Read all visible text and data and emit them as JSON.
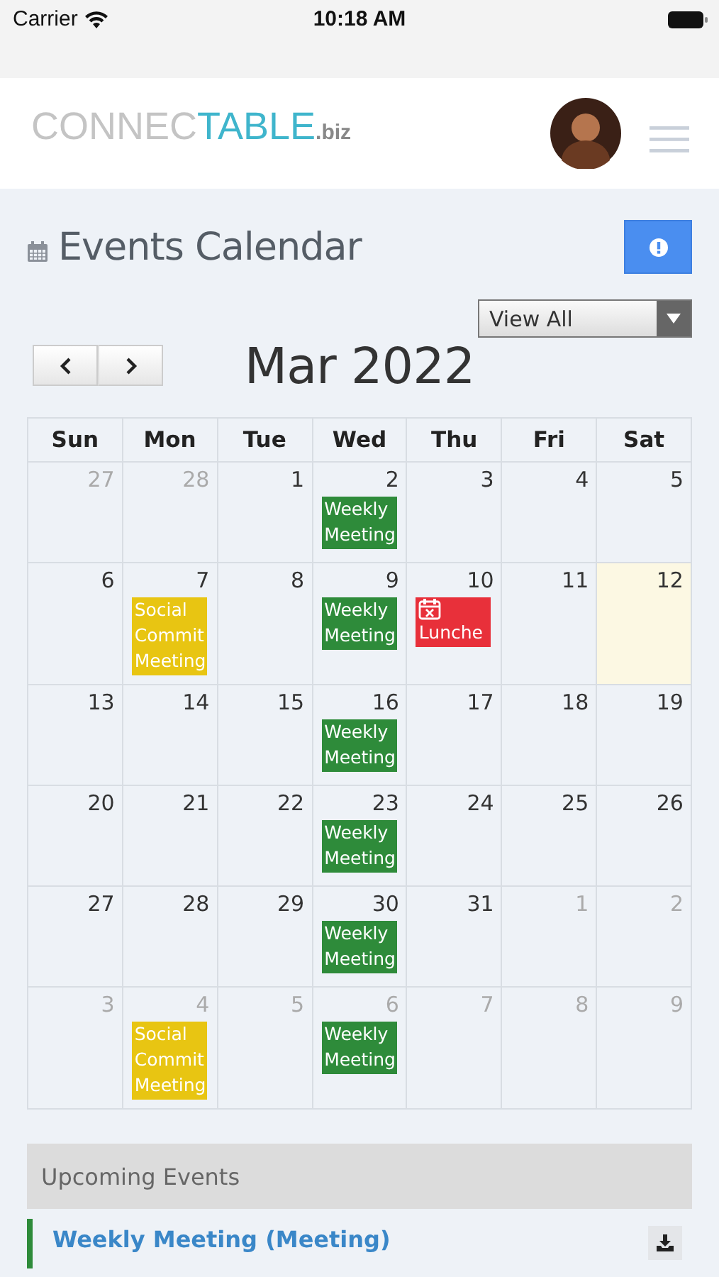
{
  "status_bar": {
    "carrier": "Carrier",
    "time": "10:18 AM"
  },
  "header": {
    "logo": {
      "part_1": "CONNEC",
      "part_2": "TABLE",
      "suffix": ".biz"
    }
  },
  "page": {
    "title": "Events Calendar"
  },
  "filter": {
    "value": "View All"
  },
  "calendar": {
    "month": "Mar 2022",
    "weekdays": [
      "Sun",
      "Mon",
      "Tue",
      "Wed",
      "Thu",
      "Fri",
      "Sat"
    ],
    "weeks": [
      [
        {
          "day": "27",
          "other_month": true,
          "today": false
        },
        {
          "day": "28",
          "other_month": true,
          "today": false
        },
        {
          "day": "1",
          "other_month": false,
          "today": false
        },
        {
          "day": "2",
          "other_month": false,
          "today": false,
          "events": [
            {
              "title": "Weekly Meeting",
              "kind": "meeting",
              "color": "#2e8b3a"
            }
          ]
        },
        {
          "day": "3",
          "other_month": false,
          "today": false
        },
        {
          "day": "4",
          "other_month": false,
          "today": false
        },
        {
          "day": "5",
          "other_month": false,
          "today": false
        }
      ],
      [
        {
          "day": "6",
          "other_month": false,
          "today": false
        },
        {
          "day": "7",
          "other_month": false,
          "today": false,
          "events": [
            {
              "title": "Social Commit Meeting",
              "kind": "meeting",
              "color": "#e8c512"
            }
          ]
        },
        {
          "day": "8",
          "other_month": false,
          "today": false
        },
        {
          "day": "9",
          "other_month": false,
          "today": false,
          "events": [
            {
              "title": "Weekly Meeting",
              "kind": "meeting",
              "color": "#2e8b3a"
            }
          ]
        },
        {
          "day": "10",
          "other_month": false,
          "today": false,
          "events": [
            {
              "title": "Lunche",
              "kind": "cancelled",
              "color": "#e8303a"
            }
          ]
        },
        {
          "day": "11",
          "other_month": false,
          "today": false
        },
        {
          "day": "12",
          "other_month": false,
          "today": true
        }
      ],
      [
        {
          "day": "13",
          "other_month": false,
          "today": false
        },
        {
          "day": "14",
          "other_month": false,
          "today": false
        },
        {
          "day": "15",
          "other_month": false,
          "today": false
        },
        {
          "day": "16",
          "other_month": false,
          "today": false,
          "events": [
            {
              "title": "Weekly Meeting",
              "kind": "meeting",
              "color": "#2e8b3a"
            }
          ]
        },
        {
          "day": "17",
          "other_month": false,
          "today": false
        },
        {
          "day": "18",
          "other_month": false,
          "today": false
        },
        {
          "day": "19",
          "other_month": false,
          "today": false
        }
      ],
      [
        {
          "day": "20",
          "other_month": false,
          "today": false
        },
        {
          "day": "21",
          "other_month": false,
          "today": false
        },
        {
          "day": "22",
          "other_month": false,
          "today": false
        },
        {
          "day": "23",
          "other_month": false,
          "today": false,
          "events": [
            {
              "title": "Weekly Meeting",
              "kind": "meeting",
              "color": "#2e8b3a"
            }
          ]
        },
        {
          "day": "24",
          "other_month": false,
          "today": false
        },
        {
          "day": "25",
          "other_month": false,
          "today": false
        },
        {
          "day": "26",
          "other_month": false,
          "today": false
        }
      ],
      [
        {
          "day": "27",
          "other_month": false,
          "today": false
        },
        {
          "day": "28",
          "other_month": false,
          "today": false
        },
        {
          "day": "29",
          "other_month": false,
          "today": false
        },
        {
          "day": "30",
          "other_month": false,
          "today": false,
          "events": [
            {
              "title": "Weekly Meeting",
              "kind": "meeting",
              "color": "#2e8b3a"
            }
          ]
        },
        {
          "day": "31",
          "other_month": false,
          "today": false
        },
        {
          "day": "1",
          "other_month": true,
          "today": false
        },
        {
          "day": "2",
          "other_month": true,
          "today": false
        }
      ],
      [
        {
          "day": "3",
          "other_month": true,
          "today": false
        },
        {
          "day": "4",
          "other_month": true,
          "today": false,
          "events": [
            {
              "title": "Social Commit Meeting",
              "kind": "meeting",
              "color": "#e8c512"
            }
          ]
        },
        {
          "day": "5",
          "other_month": true,
          "today": false
        },
        {
          "day": "6",
          "other_month": true,
          "today": false,
          "events": [
            {
              "title": "Weekly Meeting",
              "kind": "meeting",
              "color": "#2e8b3a"
            }
          ]
        },
        {
          "day": "7",
          "other_month": true,
          "today": false
        },
        {
          "day": "8",
          "other_month": true,
          "today": false
        },
        {
          "day": "9",
          "other_month": true,
          "today": false
        }
      ]
    ]
  },
  "upcoming": {
    "heading": "Upcoming Events",
    "items": [
      {
        "title": "Weekly Meeting (Meeting)",
        "color": "#2e8b3a"
      }
    ]
  }
}
